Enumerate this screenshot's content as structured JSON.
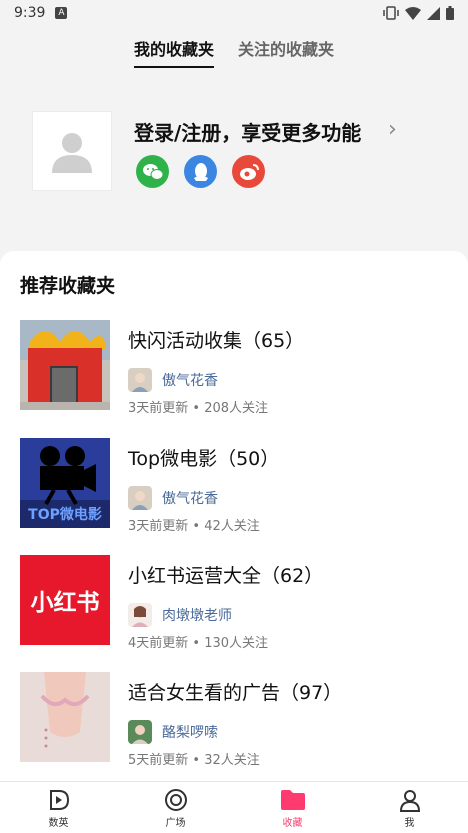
{
  "status_bar": {
    "time": "9:39",
    "notif_letter": "A"
  },
  "tabs": [
    {
      "label": "我的收藏夹",
      "active": true
    },
    {
      "label": "关注的收藏夹",
      "active": false
    }
  ],
  "profile": {
    "login_text": "登录/注册，享受更多功能",
    "chevron": "›",
    "social": [
      "wechat-icon",
      "qq-icon",
      "weibo-icon"
    ],
    "colors": {
      "wechat": "#2fb24a",
      "qq": "#3b86e0",
      "weibo": "#e8493a"
    }
  },
  "recommend": {
    "title": "推荐收藏夹",
    "items": [
      {
        "title": "快闪活动收集（65）",
        "author": "傲气花香",
        "meta": "3天前更新 • 208人关注",
        "thumb": "popup-store-thumbnail"
      },
      {
        "title": "Top微电影（50）",
        "author": "傲气花香",
        "meta": "3天前更新 • 42人关注",
        "thumb": "movie-camera-thumbnail",
        "thumb_text": "TOP微电影"
      },
      {
        "title": "小红书运营大全（62）",
        "author": "肉墩墩老师",
        "meta": "4天前更新 • 130人关注",
        "thumb": "xiaohongshu-logo-thumbnail",
        "thumb_text": "小红书"
      },
      {
        "title": "适合女生看的广告（97）",
        "author": "酪梨啰嗦",
        "meta": "5天前更新 • 32人关注",
        "thumb": "lingerie-thumbnail"
      }
    ]
  },
  "bottom_nav": [
    {
      "label": "数英",
      "icon": "shuying-logo-icon",
      "active": false
    },
    {
      "label": "广场",
      "icon": "target-circle-icon",
      "active": false
    },
    {
      "label": "收藏",
      "icon": "folder-icon",
      "active": true
    },
    {
      "label": "我",
      "icon": "person-icon",
      "active": false
    }
  ],
  "accent_color": "#ff3a6e"
}
